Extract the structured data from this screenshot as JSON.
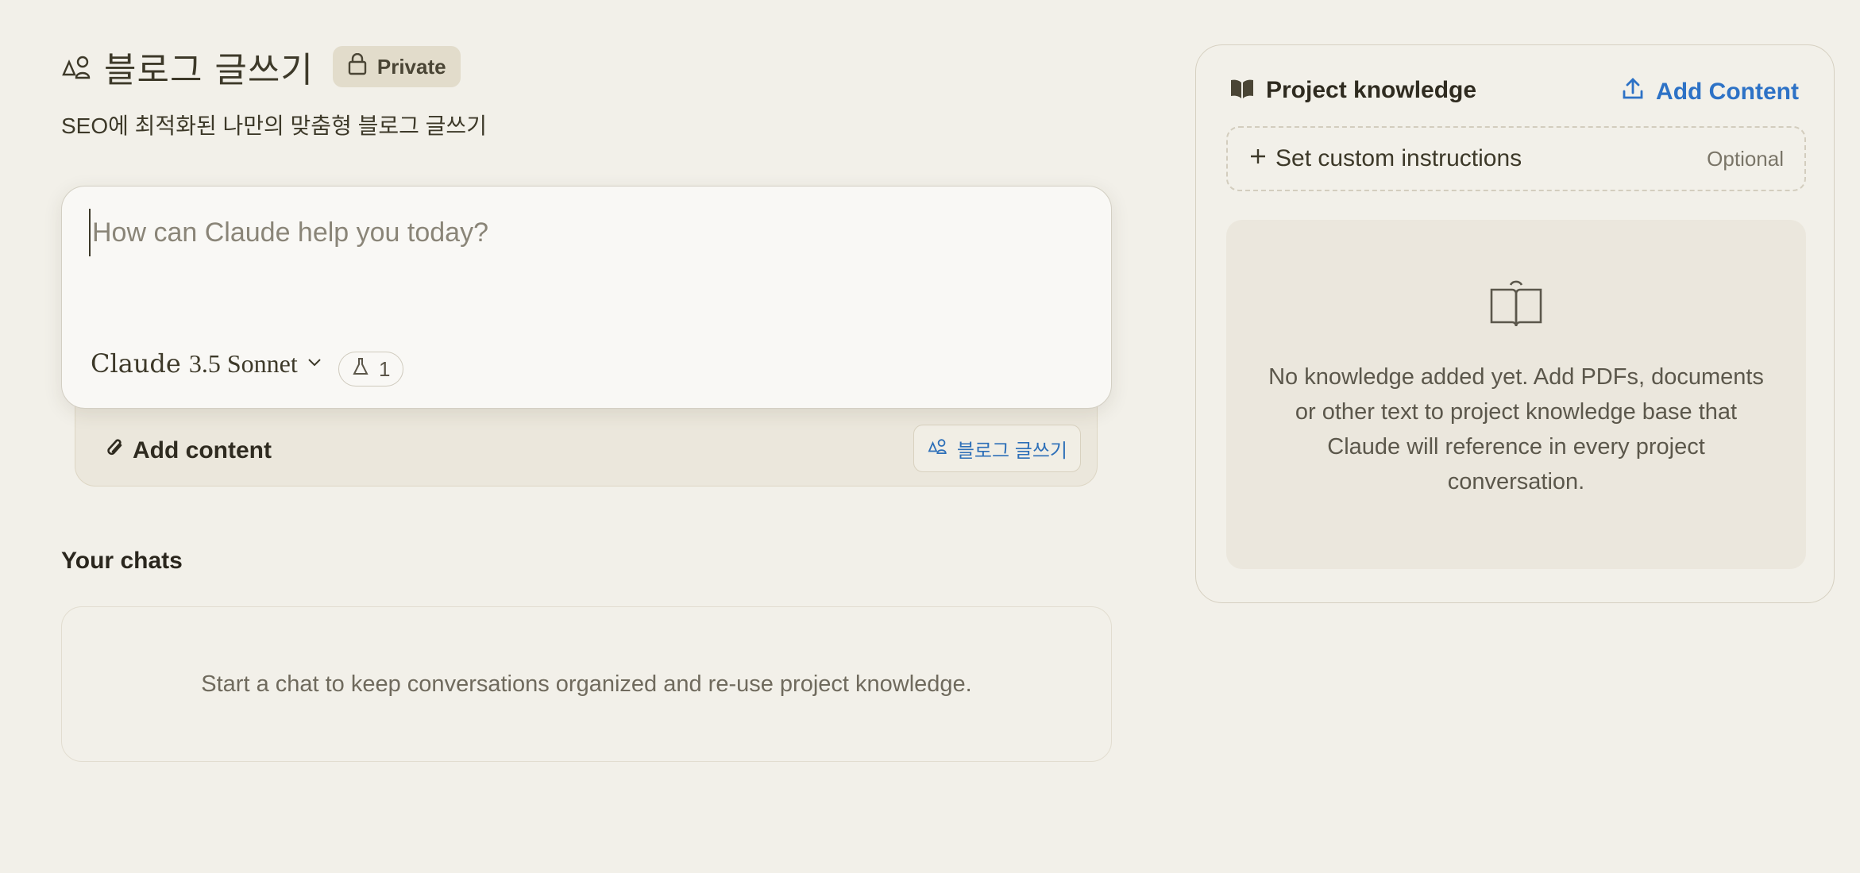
{
  "project": {
    "title": "블로그 글쓰기",
    "icon": "project-people-icon",
    "visibility_label": "Private",
    "description": "SEO에 최적화된 나만의 맞춤형 블로그 글쓰기"
  },
  "composer": {
    "placeholder": "How can Claude help you today?",
    "value": "",
    "model_brand": "Claude",
    "model_name": "3.5 Sonnet",
    "feature_count": "1",
    "add_content_label": "Add content",
    "project_chip_label": "블로그 글쓰기"
  },
  "chats": {
    "heading": "Your chats",
    "empty_message": "Start a chat to keep conversations organized and re-use project knowledge."
  },
  "knowledge": {
    "title": "Project knowledge",
    "add_content_label": "Add Content",
    "instructions_label": "Set custom instructions",
    "instructions_hint": "Optional",
    "empty_message": "No knowledge added yet. Add PDFs, documents or other text to project knowledge base that Claude will reference in every project conversation."
  },
  "colors": {
    "background": "#f2f0e9",
    "accent_blue": "#2d72c6",
    "badge_bg": "#e2dccb",
    "text": "#3d3929"
  }
}
